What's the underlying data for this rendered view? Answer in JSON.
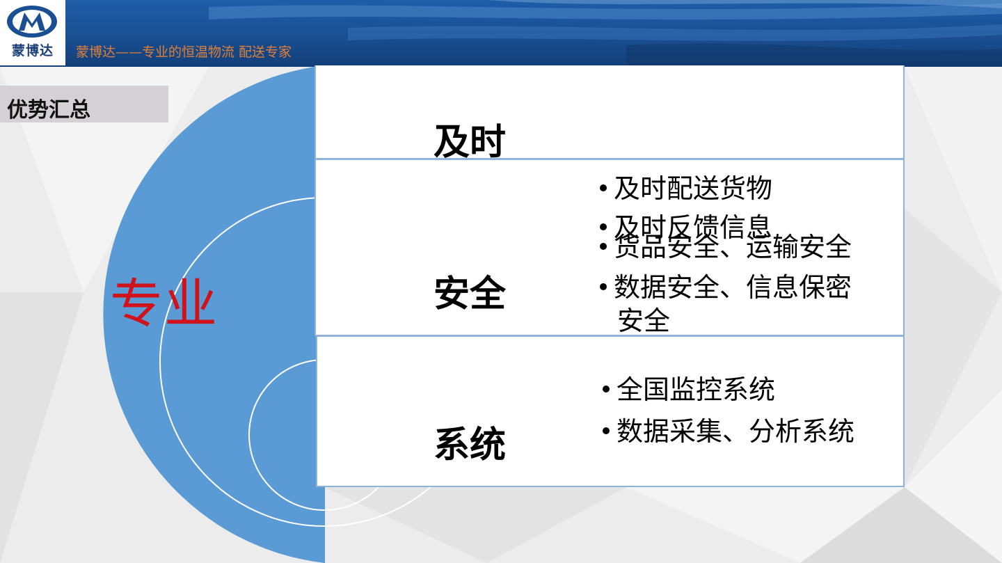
{
  "header": {
    "logo_text": "蒙博达",
    "slogan": "蒙博达——专业的恒温物流 配送专家"
  },
  "section": {
    "title": "优势汇总"
  },
  "center_word": "专业",
  "panels": [
    {
      "title": "及时",
      "bullets": [
        "及时配送货物",
        "及时反馈信息"
      ]
    },
    {
      "title": "安全",
      "bullets": [
        "货品安全、运输安全",
        "数据安全、信息保密",
        "安全"
      ]
    },
    {
      "title": "系统",
      "bullets": [
        "全国监控系统",
        "数据采集、分析系统"
      ]
    }
  ],
  "colors": {
    "header_blue": "#1a4f92",
    "circle_blue": "#5b9bd5",
    "accent_red": "#d0121b",
    "slogan_orange": "#e07f38",
    "panel_border": "#8fb3d9"
  }
}
